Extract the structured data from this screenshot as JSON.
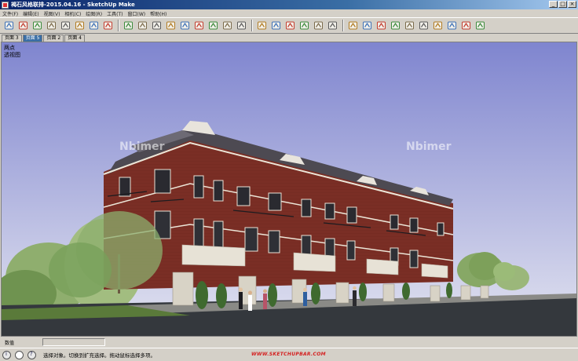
{
  "window": {
    "title": "褐石风格联排-2015.04.16 - SketchUp Make",
    "controls": {
      "minimize": "_",
      "maximize": "□",
      "close": "×"
    }
  },
  "menu": [
    "文件(F)",
    "编辑(E)",
    "视图(V)",
    "相机(C)",
    "绘图(R)",
    "工具(T)",
    "窗口(W)",
    "帮助(H)"
  ],
  "toolbar": {
    "icons": [
      "select-icon",
      "eraser-icon",
      "paint-icon",
      "line-icon",
      "rectangle-icon",
      "push-pull-icon",
      "offset-icon",
      "component-icon",
      "orbit-icon",
      "pan-icon",
      "zoom-icon",
      "zoom-window-icon",
      "zoom-extents-icon",
      "previous-view-icon",
      "walk-icon",
      "look-around-icon",
      "position-camera-icon",
      "iso-view-icon",
      "top-view-icon",
      "front-view-icon",
      "right-view-icon",
      "back-view-icon",
      "left-view-icon",
      "section-plane-icon",
      "open-folder-icon",
      "save-icon",
      "cut-icon",
      "copy-icon",
      "delete-icon",
      "undo-icon",
      "redo-icon",
      "print-icon",
      "model-info-icon"
    ]
  },
  "tabs": [
    {
      "label": "页面 3",
      "active": false
    },
    {
      "label": "页面 5",
      "active": true
    },
    {
      "label": "页面 2",
      "active": false
    },
    {
      "label": "页面 4",
      "active": false
    }
  ],
  "viewport": {
    "perspective_label": "两点",
    "view_label": "透视图",
    "watermark": "Nbimer",
    "sky_top": "#7f85cf",
    "sky_bottom": "#e3e4f0",
    "ground": "#34383d"
  },
  "vcb": {
    "label": "数值"
  },
  "status": {
    "hint": "选择对象。切换到扩充选择。拖动鼠标选择多项。",
    "site": "WWW.SKETCHUPBAR.COM"
  }
}
